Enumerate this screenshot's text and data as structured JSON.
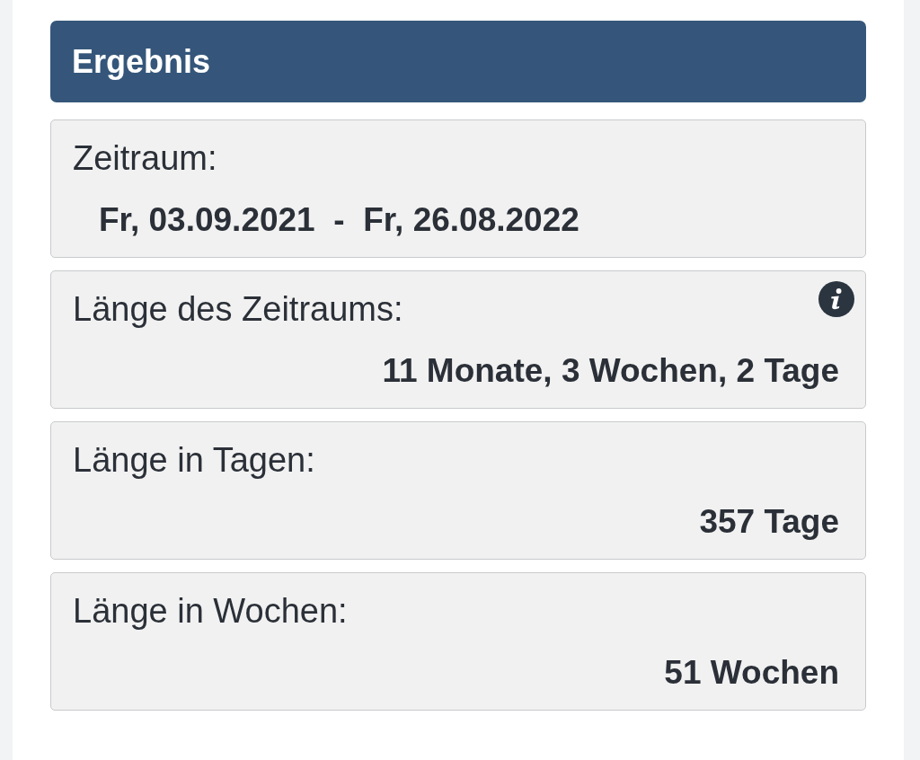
{
  "header": {
    "title": "Ergebnis"
  },
  "results": [
    {
      "kind": "range",
      "label": "Zeitraum:",
      "value": "Fr, 03.09.2021  -  Fr, 26.08.2022",
      "info": false
    },
    {
      "kind": "length",
      "label": "Länge des Zeitraums:",
      "value": "11 Monate, 3 Wochen, 2 Tage",
      "info": true
    },
    {
      "kind": "length",
      "label": "Länge in Tagen:",
      "value": "357 Tage",
      "info": false
    },
    {
      "kind": "length",
      "label": "Länge in Wochen:",
      "value": "51 Wochen",
      "info": false
    }
  ]
}
